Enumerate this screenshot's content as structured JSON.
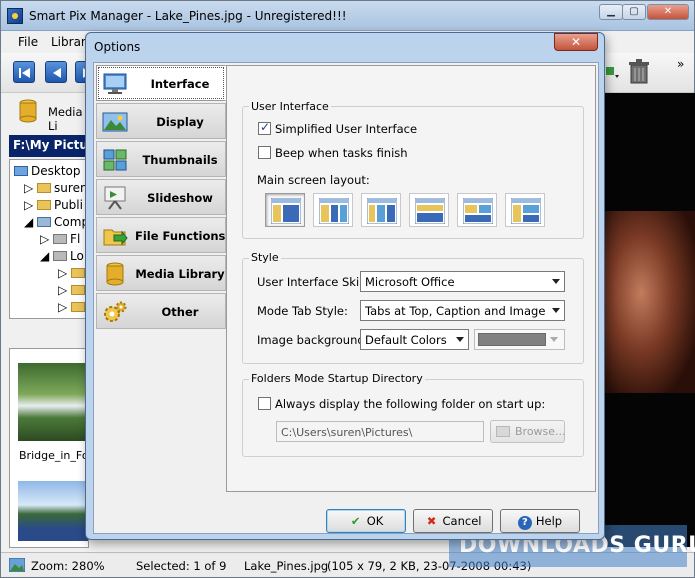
{
  "app": {
    "title": "Smart Pix Manager - Lake_Pines.jpg - Unregistered!!!",
    "menu": [
      "File",
      "Library"
    ],
    "media_label": "Media Li",
    "path": "F:\\My Pictures",
    "tree": [
      "Desktop",
      "suren",
      "Publi",
      "Comp",
      "Fl",
      "Lo"
    ],
    "thumbs": [
      "Bridge_in_For"
    ]
  },
  "status": {
    "zoom": "Zoom: 280%",
    "selected": "Selected: 1 of 9",
    "file": "Lake_Pines.jpg",
    "info": "(105 x 79, 2 KB, 23-07-2008 00:43)"
  },
  "watermark": "DOWNLOADS  GURU",
  "dialog": {
    "title": "Options",
    "close": "✕",
    "tabs": [
      {
        "label": "Interface",
        "icon": "monitor-icon"
      },
      {
        "label": "Display",
        "icon": "landscape-icon"
      },
      {
        "label": "Thumbnails",
        "icon": "thumbnails-icon"
      },
      {
        "label": "Slideshow",
        "icon": "projector-icon"
      },
      {
        "label": "File Functions",
        "icon": "folder-arrow-icon"
      },
      {
        "label": "Media Library",
        "icon": "database-icon"
      },
      {
        "label": "Other",
        "icon": "gears-icon"
      }
    ],
    "user_interface": {
      "group_title": "User Interface",
      "simplified_label": "Simplified User Interface",
      "simplified_checked": true,
      "beep_label": "Beep when tasks finish",
      "beep_checked": false,
      "layout_label": "Main screen layout:",
      "selected_layout": 1
    },
    "style": {
      "group_title": "Style",
      "skin_label": "User Interface Skin:",
      "skin_value": "Microsoft Office",
      "tab_style_label": "Mode Tab Style:",
      "tab_style_value": "Tabs at Top, Caption and Image",
      "bg_label": "Image background:",
      "bg_value": "Default Colors",
      "bg_color": "#808080"
    },
    "folders": {
      "group_title": "Folders Mode Startup Directory",
      "always_label": "Always display the following folder on start up:",
      "always_checked": false,
      "path_value": "C:\\Users\\suren\\Pictures\\",
      "browse_label": "Browse..."
    },
    "buttons": {
      "ok": "OK",
      "cancel": "Cancel",
      "help": "Help"
    }
  }
}
